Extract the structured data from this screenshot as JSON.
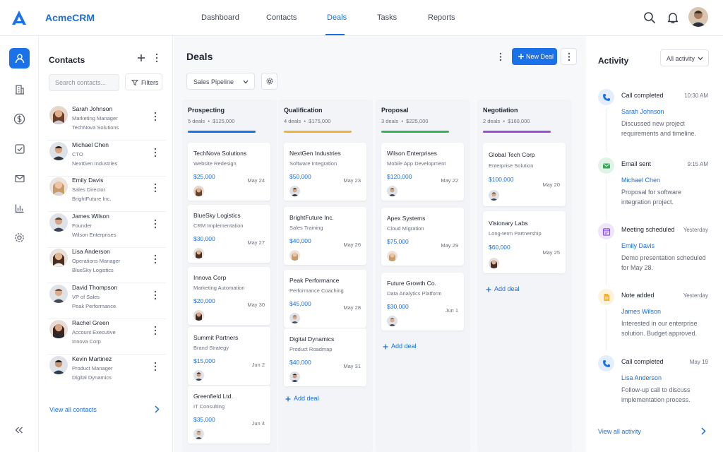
{
  "app": {
    "name": "AcmeCRM",
    "accent": "#1b72e8"
  },
  "nav": [
    {
      "label": "Dashboard"
    },
    {
      "label": "Contacts"
    },
    {
      "label": "Deals",
      "active": true
    },
    {
      "label": "Tasks"
    },
    {
      "label": "Reports"
    }
  ],
  "header_icons": [
    "search-icon",
    "bell-icon",
    "avatar"
  ],
  "left_rail": [
    "user-icon",
    "building-icon",
    "dollar-icon",
    "checkbox-icon",
    "mail-icon",
    "bar-chart-icon",
    "gear-icon",
    "collapse-icon"
  ],
  "contacts": {
    "title": "Contacts",
    "search_placeholder": "Search contacts...",
    "filters_label": "Filters",
    "items": [
      {
        "name": "Sarah Johnson",
        "role": "Marketing Manager",
        "company": "TechNova Solutions"
      },
      {
        "name": "Michael Chen",
        "role": "CTO",
        "company": "NextGen Industries"
      },
      {
        "name": "Emily Davis",
        "role": "Sales Director",
        "company": "BrightFuture Inc."
      },
      {
        "name": "James Wilson",
        "role": "Founder",
        "company": "Wilson Enterprises"
      },
      {
        "name": "Lisa Anderson",
        "role": "Operations Manager",
        "company": "BlueSky Logistics"
      },
      {
        "name": "David Thompson",
        "role": "VP of Sales",
        "company": "Peak Performance"
      },
      {
        "name": "Rachel Green",
        "role": "Account Executive",
        "company": "Innova Corp"
      },
      {
        "name": "Kevin Martinez",
        "role": "Product Manager",
        "company": "Digital Dynamics"
      }
    ],
    "view_all": "View all contacts"
  },
  "deals": {
    "title": "Deals",
    "pipeline": "Sales Pipeline",
    "new_deal": "New Deal",
    "add_deal": "Add deal",
    "columns": [
      {
        "title": "Prospecting",
        "count": "5 deals",
        "amount": "$125,000",
        "color": "#1b72e8",
        "deals": [
          {
            "company": "TechNova Solutions",
            "product": "Website Redesign",
            "value": "$25,000",
            "date": "May 24"
          },
          {
            "company": "BlueSky Logistics",
            "product": "CRM Implementation",
            "value": "$30,000",
            "date": "May 27"
          },
          {
            "company": "Innova Corp",
            "product": "Marketing Automation",
            "value": "$20,000",
            "date": "May 30"
          },
          {
            "company": "Summit Partners",
            "product": "Brand Strategy",
            "value": "$15,000",
            "date": "Jun 2"
          },
          {
            "company": "Greenfield Ltd.",
            "product": "IT Consulting",
            "value": "$35,000",
            "date": "Jun 4"
          }
        ]
      },
      {
        "title": "Qualification",
        "count": "4 deals",
        "amount": "$175,000",
        "color": "#f2b134",
        "deals": [
          {
            "company": "NextGen Industries",
            "product": "Software Integration",
            "value": "$50,000",
            "date": "May 23"
          },
          {
            "company": "BrightFuture Inc.",
            "product": "Sales Training",
            "value": "$40,000",
            "date": "May 26"
          },
          {
            "company": "Peak Performance",
            "product": "Performance Coaching",
            "value": "$45,000",
            "date": "May 28"
          },
          {
            "company": "Digital Dynamics",
            "product": "Product Roadmap",
            "value": "$40,000",
            "date": "May 31"
          }
        ]
      },
      {
        "title": "Proposal",
        "count": "3 deals",
        "amount": "$225,000",
        "color": "#34b35a",
        "deals": [
          {
            "company": "Wilson Enterprises",
            "product": "Mobile App Development",
            "value": "$120,000",
            "date": "May 22"
          },
          {
            "company": "Apex Systems",
            "product": "Cloud Migration",
            "value": "$75,000",
            "date": "May 29"
          },
          {
            "company": "Future Growth Co.",
            "product": "Data Analytics Platform",
            "value": "$30,000",
            "date": "Jun 1"
          }
        ]
      },
      {
        "title": "Negotiation",
        "count": "2 deals",
        "amount": "$160,000",
        "color": "#9b4fd6",
        "deals": [
          {
            "company": "Global Tech Corp",
            "product": "Enterprise Solution",
            "value": "$100,000",
            "date": "May 20"
          },
          {
            "company": "Visionary Labs",
            "product": "Long-term Partnership",
            "value": "$60,000",
            "date": "May 25"
          }
        ]
      }
    ]
  },
  "activity": {
    "title": "Activity",
    "filter": "All activity",
    "items": [
      {
        "type": "Call completed",
        "time": "10:30 AM",
        "person": "Sarah Johnson",
        "desc": "Discussed new project requirements and timeline.",
        "icon": "phone-icon",
        "color": "#1b72e8"
      },
      {
        "type": "Email sent",
        "time": "9:15 AM",
        "person": "Michael Chen",
        "desc": "Proposal for software integration project.",
        "icon": "email-icon",
        "color": "#35a957"
      },
      {
        "type": "Meeting scheduled",
        "time": "Yesterday",
        "person": "Emily Davis",
        "desc": "Demo presentation scheduled for May 28.",
        "icon": "calendar-icon",
        "color": "#8a4fd6"
      },
      {
        "type": "Note added",
        "time": "Yesterday",
        "person": "James Wilson",
        "desc": "Interested in our enterprise solution. Budget approved.",
        "icon": "note-icon",
        "color": "#f2b134"
      },
      {
        "type": "Call completed",
        "time": "May 19",
        "person": "Lisa Anderson",
        "desc": "Follow-up call to discuss implementation process.",
        "icon": "phone-icon",
        "color": "#1b72e8"
      }
    ],
    "view_all": "View all activity"
  }
}
